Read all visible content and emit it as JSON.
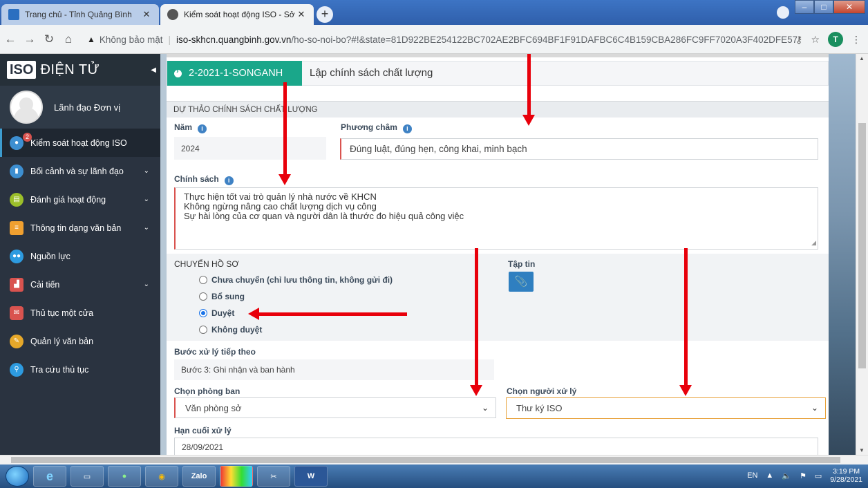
{
  "browser": {
    "tabs": [
      {
        "title": "Trang chủ - Tỉnh Quảng Bình",
        "active": false
      },
      {
        "title": "Kiểm soát hoạt động ISO - Sở Kh",
        "active": true
      }
    ],
    "address": {
      "security_label": "Không bảo mật",
      "host": "iso-skhcn.quangbinh.gov.vn",
      "path": "/ho-so-noi-bo?#!&state=81D922BE254122BC702AE2BFC694BF1F91DAFBC6C4B159CBA286FC9FF7020A3F402DFE57D7EB..."
    },
    "profile_initial": "T"
  },
  "sidebar": {
    "brand_box": "ISO",
    "brand_text": "ĐIỆN TỬ",
    "user_name": "Lãnh đạo Đơn vị",
    "items": [
      {
        "label": "Kiểm soát hoạt động ISO",
        "badge": "2",
        "color": "#3d8fd1",
        "active": true,
        "has_children": false
      },
      {
        "label": "Bối cảnh và sự lãnh đạo",
        "color": "#3d8fd1",
        "has_children": true
      },
      {
        "label": "Đánh giá hoạt động",
        "color": "#9bbf2a",
        "has_children": true
      },
      {
        "label": "Thông tin dạng văn bản",
        "color": "#f0a030",
        "has_children": true
      },
      {
        "label": "Nguồn lực",
        "color": "#2d9be0",
        "has_children": false
      },
      {
        "label": "Cải tiến",
        "color": "#d9534f",
        "has_children": true
      },
      {
        "label": "Thủ tục một cửa",
        "color": "#d9534f",
        "has_children": false
      },
      {
        "label": "Quản lý văn bản",
        "color": "#e6a82a",
        "has_children": false
      },
      {
        "label": "Tra cứu thủ tục",
        "color": "#2d9be0",
        "has_children": false
      }
    ]
  },
  "main": {
    "code": "2-2021-1-SONGANH",
    "title": "Lập chính sách chất lượng",
    "section": "DỰ THẢO CHÍNH SÁCH CHẤT LƯỢNG",
    "year_label": "Năm",
    "year_value": "2024",
    "motto_label": "Phương châm",
    "motto_value": "Đúng luật, đúng hẹn, công khai, minh bạch",
    "policy_label": "Chính sách",
    "policy_lines": [
      "Thực hiện tốt vai trò quản lý nhà nước về KHCN",
      "Không ngừng nâng cao chất lượng dịch vụ công",
      "Sự hài lòng của cơ quan và người dân là thước đo hiệu quả công việc"
    ],
    "transfer_label": "CHUYỂN HỒ SƠ",
    "transfer_options": [
      {
        "label": "Chưa chuyển (chỉ lưu thông tin, không gửi đi)",
        "checked": false
      },
      {
        "label": "Bổ sung",
        "checked": false
      },
      {
        "label": "Duyệt",
        "checked": true
      },
      {
        "label": "Không duyệt",
        "checked": false
      }
    ],
    "file_label": "Tập tin",
    "next_step_label": "Bước xử lý tiếp theo",
    "next_step_value": "Bước 3: Ghi nhận và ban hành",
    "dept_label": "Chọn phòng ban",
    "dept_value": "Văn phòng sở",
    "handler_label": "Chọn người xử lý",
    "handler_value": "Thư ký ISO",
    "deadline_label": "Hạn cuối xử lý",
    "deadline_value": "28/09/2021"
  },
  "taskbar": {
    "apps": [
      "Zalo",
      "W"
    ],
    "lang": "EN",
    "time": "3:19 PM",
    "date": "9/28/2021"
  }
}
